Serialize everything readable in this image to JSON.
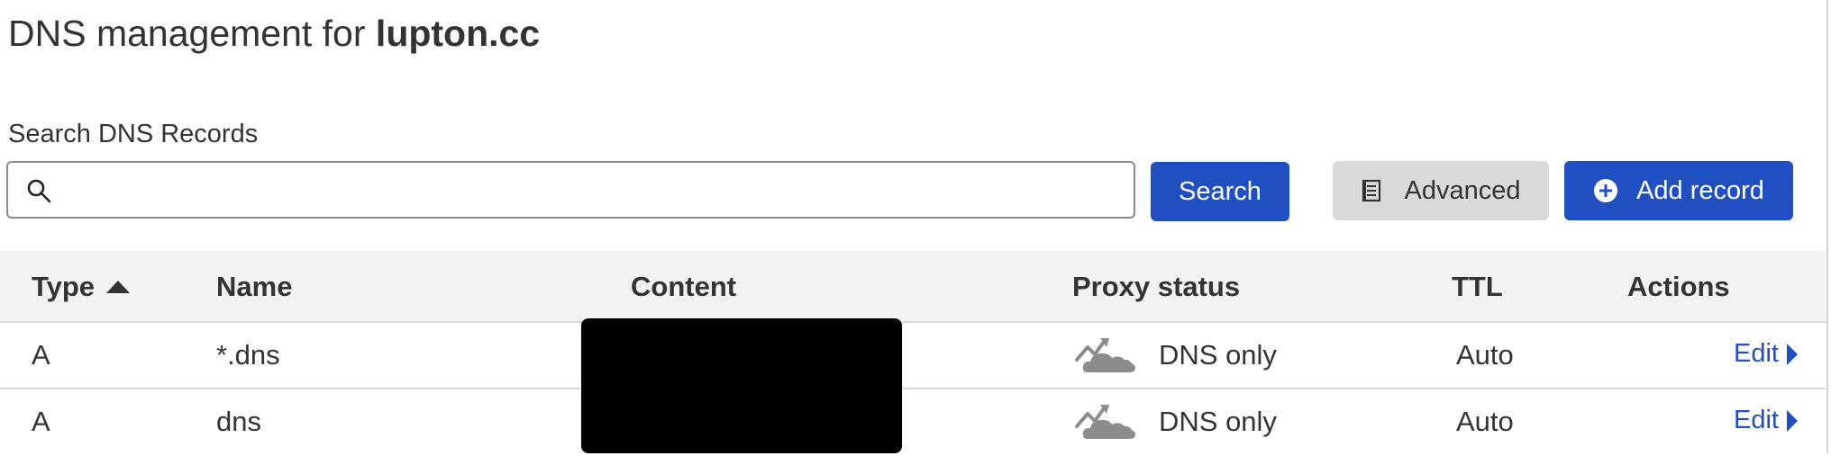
{
  "header": {
    "title_prefix": "DNS management for",
    "domain": "lupton.cc"
  },
  "search": {
    "label": "Search DNS Records",
    "value": "",
    "placeholder": ""
  },
  "buttons": {
    "search": "Search",
    "advanced": "Advanced",
    "add_record": "Add record"
  },
  "table": {
    "columns": {
      "type": "Type",
      "name": "Name",
      "content": "Content",
      "proxy_status": "Proxy status",
      "ttl": "TTL",
      "actions": "Actions"
    },
    "sort": {
      "column": "type",
      "direction": "ascending"
    },
    "rows": [
      {
        "type": "A",
        "name": "*.dns",
        "content": "[redacted]",
        "proxy_status": "DNS only",
        "ttl": "Auto",
        "action": "Edit"
      },
      {
        "type": "A",
        "name": "dns",
        "content": "[redacted]",
        "proxy_status": "DNS only",
        "ttl": "Auto",
        "action": "Edit"
      }
    ]
  },
  "icons": {
    "search": "search-icon",
    "advanced": "document-icon",
    "add": "plus-circle-icon",
    "sort": "sort-up-icon",
    "proxy": "dns-only-cloud-icon",
    "edit": "caret-right-icon"
  },
  "colors": {
    "primary": "#1f4fc1",
    "secondary_button": "#d9d9d9",
    "header_bg": "#f2f2f2",
    "cloud_gray": "#8c8c8c"
  }
}
